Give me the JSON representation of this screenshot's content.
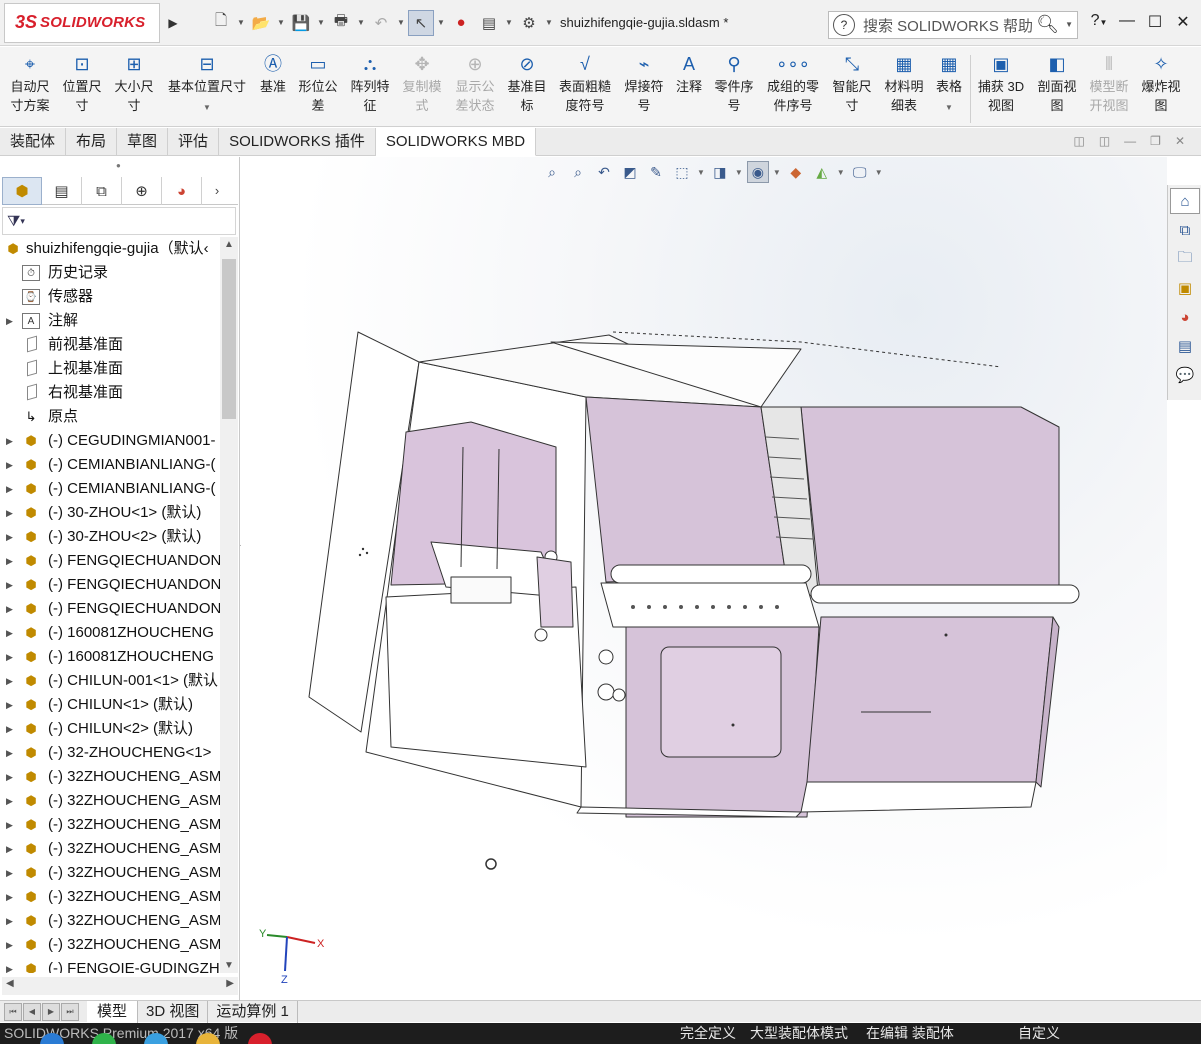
{
  "titlebar": {
    "logo_ds": "3S",
    "logo_text": "SOLIDWORKS",
    "document_title": "shuizhifengqie-gujia.sldasm *",
    "search_placeholder": "搜索 SOLIDWORKS 帮助",
    "help_label": "?",
    "window_min": "—",
    "window_max": "☐",
    "window_close": "✕"
  },
  "command_manager": {
    "buttons": [
      {
        "line1": "自动尺",
        "line2": "寸方案",
        "icon": "auto-dimension-icon",
        "enabled": true
      },
      {
        "line1": "位置尺",
        "line2": "寸",
        "icon": "location-dimension-icon",
        "enabled": true
      },
      {
        "line1": "大小尺",
        "line2": "寸",
        "icon": "size-dimension-icon",
        "enabled": true
      },
      {
        "line1": "基本位置尺寸",
        "line2": "",
        "icon": "basic-location-dimension-icon",
        "enabled": true
      },
      {
        "line1": "基准",
        "line2": "",
        "icon": "datum-icon",
        "enabled": true
      },
      {
        "line1": "形位公",
        "line2": "差",
        "icon": "geometric-tolerance-icon",
        "enabled": true
      },
      {
        "line1": "阵列特",
        "line2": "征",
        "icon": "pattern-feature-icon",
        "enabled": true
      },
      {
        "line1": "复制模",
        "line2": "式",
        "icon": "copy-scheme-icon",
        "enabled": false
      },
      {
        "line1": "显示公",
        "line2": "差状态",
        "icon": "show-tolerance-status-icon",
        "enabled": false
      },
      {
        "line1": "基准目",
        "line2": "标",
        "icon": "datum-target-icon",
        "enabled": true
      },
      {
        "line1": "表面粗糙",
        "line2": "度符号",
        "icon": "surface-finish-icon",
        "enabled": true
      },
      {
        "line1": "焊接符",
        "line2": "号",
        "icon": "weld-symbol-icon",
        "enabled": true
      },
      {
        "line1": "注释",
        "line2": "",
        "icon": "note-icon",
        "enabled": true
      },
      {
        "line1": "零件序",
        "line2": "号",
        "icon": "balloon-icon",
        "enabled": true
      },
      {
        "line1": "成组的零",
        "line2": "件序号",
        "icon": "stacked-balloon-icon",
        "enabled": true
      },
      {
        "line1": "智能尺",
        "line2": "寸",
        "icon": "smart-dimension-icon",
        "enabled": true
      },
      {
        "line1": "材料明",
        "line2": "细表",
        "icon": "bom-icon",
        "enabled": true
      },
      {
        "line1": "表格",
        "line2": "",
        "icon": "table-icon",
        "enabled": true
      },
      {
        "line1": "捕获 3D",
        "line2": "视图",
        "icon": "capture-3d-view-icon",
        "enabled": true
      },
      {
        "line1": "剖面视",
        "line2": "图",
        "icon": "section-view-icon",
        "enabled": true
      },
      {
        "line1": "模型断",
        "line2": "开视图",
        "icon": "model-break-view-icon",
        "enabled": false
      },
      {
        "line1": "爆炸视",
        "line2": "图",
        "icon": "exploded-view-icon",
        "enabled": true
      }
    ]
  },
  "tabs": [
    "装配体",
    "布局",
    "草图",
    "评估",
    "SOLIDWORKS 插件",
    "SOLIDWORKS MBD"
  ],
  "active_tab": "SOLIDWORKS MBD",
  "tree": {
    "root": "shuizhifengqie-gujia（默认‹",
    "items": [
      {
        "label": "历史记录",
        "icon": "history-icon",
        "expandable": false
      },
      {
        "label": "传感器",
        "icon": "sensor-icon",
        "expandable": false
      },
      {
        "label": "注解",
        "icon": "annotation-icon",
        "expandable": true
      },
      {
        "label": "前视基准面",
        "icon": "plane-icon",
        "expandable": false
      },
      {
        "label": "上视基准面",
        "icon": "plane-icon",
        "expandable": false
      },
      {
        "label": "右视基准面",
        "icon": "plane-icon",
        "expandable": false
      },
      {
        "label": "原点",
        "icon": "origin-icon",
        "expandable": false
      },
      {
        "label": "(-) CEGUDINGMIAN001-",
        "icon": "part-icon",
        "expandable": true
      },
      {
        "label": "(-) CEMIANBIANLIANG-(",
        "icon": "part-icon",
        "expandable": true
      },
      {
        "label": "(-) CEMIANBIANLIANG-(",
        "icon": "part-icon",
        "expandable": true
      },
      {
        "label": "(-) 30-ZHOU<1> (默认)",
        "icon": "part-icon",
        "expandable": true
      },
      {
        "label": "(-) 30-ZHOU<2> (默认)",
        "icon": "part-icon",
        "expandable": true
      },
      {
        "label": "(-) FENGQIECHUANDON",
        "icon": "part-icon",
        "expandable": true
      },
      {
        "label": "(-) FENGQIECHUANDON",
        "icon": "part-icon",
        "expandable": true
      },
      {
        "label": "(-) FENGQIECHUANDON",
        "icon": "part-icon",
        "expandable": true
      },
      {
        "label": "(-) 160081ZHOUCHENG",
        "icon": "part-icon",
        "expandable": true
      },
      {
        "label": "(-) 160081ZHOUCHENG",
        "icon": "part-icon",
        "expandable": true
      },
      {
        "label": "(-) CHILUN-001<1> (默认",
        "icon": "part-icon",
        "expandable": true
      },
      {
        "label": "(-) CHILUN<1> (默认)",
        "icon": "part-icon",
        "expandable": true
      },
      {
        "label": "(-) CHILUN<2> (默认)",
        "icon": "part-icon",
        "expandable": true
      },
      {
        "label": "(-) 32-ZHOUCHENG<1>",
        "icon": "part-icon",
        "expandable": true
      },
      {
        "label": "(-) 32ZHOUCHENG_ASM",
        "icon": "part-icon",
        "expandable": true
      },
      {
        "label": "(-) 32ZHOUCHENG_ASM",
        "icon": "part-icon",
        "expandable": true
      },
      {
        "label": "(-) 32ZHOUCHENG_ASM",
        "icon": "part-icon",
        "expandable": true
      },
      {
        "label": "(-) 32ZHOUCHENG_ASM",
        "icon": "part-icon",
        "expandable": true
      },
      {
        "label": "(-) 32ZHOUCHENG_ASM",
        "icon": "part-icon",
        "expandable": true
      },
      {
        "label": "(-) 32ZHOUCHENG_ASM",
        "icon": "part-icon",
        "expandable": true
      },
      {
        "label": "(-) 32ZHOUCHENG_ASM",
        "icon": "part-icon",
        "expandable": true
      },
      {
        "label": "(-) 32ZHOUCHENG_ASM",
        "icon": "part-icon",
        "expandable": true
      },
      {
        "label": "(-) FENGQIE-GUDINGZH",
        "icon": "part-icon",
        "expandable": true
      }
    ]
  },
  "bottom_tabs": [
    "模型",
    "3D 视图",
    "运动算例 1"
  ],
  "active_bottom_tab": "模型",
  "status": {
    "product": "SOLIDWORKS Premium 2017 x64 版",
    "state": "完全定义",
    "mode": "大型装配体模式",
    "editing": "在编辑 装配体",
    "custom": "自定义"
  },
  "triad": {
    "x": "X",
    "y": "Y",
    "z": "Z"
  },
  "colors": {
    "accent": "#d8202c",
    "model_panel": "#d9c4dc",
    "highlight": "#1d5fae"
  }
}
